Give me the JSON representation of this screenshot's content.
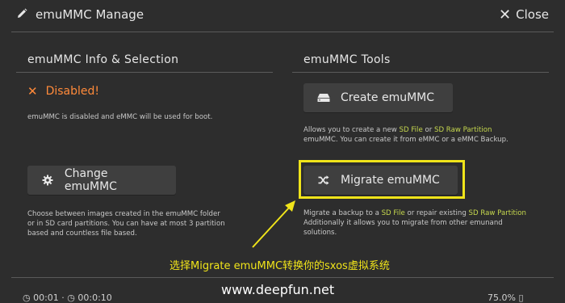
{
  "header": {
    "title": "emuMMC Manage",
    "close_label": "Close"
  },
  "left": {
    "section_title": "emuMMC Info & Selection",
    "status_text": "Disabled!",
    "status_desc": "emuMMC is disabled and eMMC will be used for boot.",
    "change_button": "Change emuMMC",
    "change_desc_lines": [
      "Choose between images created in the emuMMC folder",
      "or in SD card partitions. You can have at most 3 partition",
      "based and countless file based."
    ]
  },
  "right": {
    "section_title": "emuMMC Tools",
    "create_button": "Create emuMMC",
    "create_desc": {
      "l1_pre": "Allows you to create a new ",
      "l1_hl1": "SD File",
      "l1_mid": " or ",
      "l1_hl2": "SD Raw Partition",
      "l2": "emuMMC. You can create it from eMMC or a eMMC Backup."
    },
    "migrate_button": "Migrate emuMMC",
    "migrate_desc": {
      "l1_pre": "Migrate a backup to a ",
      "l1_hl1": "SD File",
      "l1_mid": " or repair existing ",
      "l1_hl2": "SD Raw Partition",
      "l2": "Additionally it allows you to migrate from other emunand",
      "l3": "solutions."
    }
  },
  "annotation": {
    "text": "选择Migrate emuMMC转换你的sxos虚拟系统",
    "highlight_color": "#f0e41a"
  },
  "watermark": "www.deepfun.net",
  "footer": {
    "left_fragment": "◷ 00:01 · ◷ 00:0:10",
    "right_fragment": "75.0% ▯"
  },
  "colors": {
    "background": "#2d2d2d",
    "status_orange": "#ff8a3a",
    "link_green": "#c6d84e",
    "button_bg": "#3f3f3f"
  },
  "icons": {
    "header": "pencil-icon",
    "close": "close-icon",
    "status": "x-icon",
    "change": "gear-icon",
    "create": "drive-icon",
    "migrate": "shuffle-icon"
  }
}
